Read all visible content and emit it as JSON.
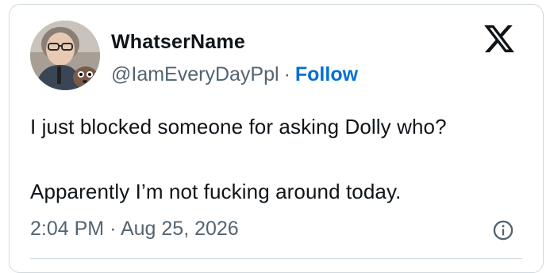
{
  "author": {
    "display_name": "WhatserName",
    "handle": "@IamEveryDayPpl",
    "separator": "·",
    "follow_label": "Follow"
  },
  "tweet": {
    "lines": [
      "I just blocked someone for asking Dolly who?",
      "Apparently I’m not fucking around today."
    ],
    "time": "2:04 PM",
    "dot": "·",
    "date": "Aug 25, 2026"
  },
  "icons": {
    "brand": "x-logo-icon",
    "info": "info-icon"
  },
  "colors": {
    "text_primary": "#0f1419",
    "text_secondary": "#536471",
    "follow": "#006fd6",
    "border": "#cfd9de"
  }
}
